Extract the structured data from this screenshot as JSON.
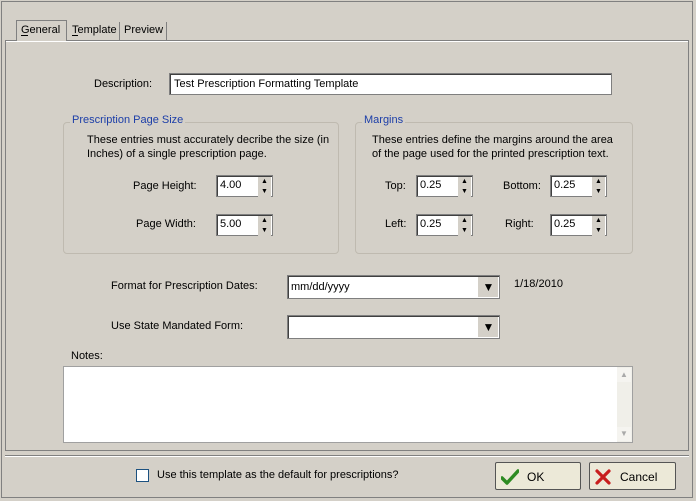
{
  "tabs": [
    {
      "label": "General",
      "active": true
    },
    {
      "label": "Template",
      "active": false
    },
    {
      "label": "Preview",
      "active": false
    }
  ],
  "description": {
    "label": "Description:",
    "value": "Test Prescription Formatting Template"
  },
  "page_size": {
    "title": "Prescription Page Size",
    "info": "These entries must accurately decribe the size (in Inches) of a single prescription page.",
    "height_label": "Page Height:",
    "height_value": "4.00",
    "width_label": "Page Width:",
    "width_value": "5.00"
  },
  "margins": {
    "title": "Margins",
    "info": "These entries define the margins around the area of the page used for the printed prescription text.",
    "top_label": "Top:",
    "top_value": "0.25",
    "bottom_label": "Bottom:",
    "bottom_value": "0.25",
    "left_label": "Left:",
    "left_value": "0.25",
    "right_label": "Right:",
    "right_value": "0.25"
  },
  "date_format": {
    "label": "Format for Prescription Dates:",
    "value": "mm/dd/yyyy",
    "preview": "1/18/2010"
  },
  "state_form": {
    "label": "Use State Mandated Form:",
    "value": ""
  },
  "notes": {
    "label": "Notes:",
    "value": ""
  },
  "default_checkbox": {
    "label": "Use this template as the default for prescriptions?",
    "checked": false
  },
  "buttons": {
    "ok": "OK",
    "cancel": "Cancel"
  },
  "colors": {
    "face": "#d4d0c8",
    "group_title": "#1c3ea8",
    "ok_check": "#2e8b22",
    "cancel_x": "#c81e1e"
  },
  "icons": {
    "spin_up": "up-arrow-icon",
    "spin_down": "down-arrow-icon",
    "combo": "chevron-down-icon",
    "ok": "checkmark-icon",
    "cancel": "x-icon"
  }
}
